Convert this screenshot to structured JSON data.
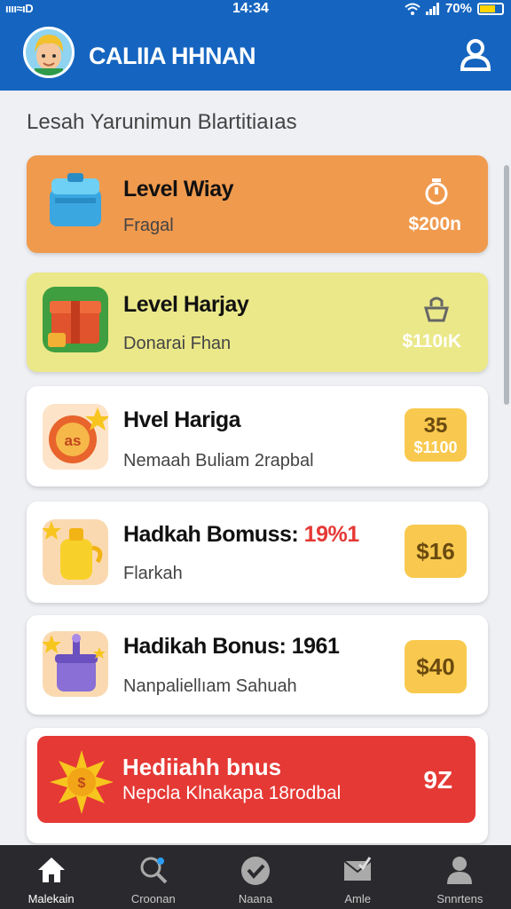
{
  "status_bar": {
    "left": "ıııı≈ıD",
    "time": "14:34",
    "battery": "70%"
  },
  "header": {
    "title": "CALIIA HHNAN"
  },
  "section_title": "Lesah Yarunimun Blartitiaıas",
  "cards": [
    {
      "title": "Level Wiay",
      "subtitle": "Fragal",
      "price": "$200n"
    },
    {
      "title": "Level Harjay",
      "subtitle": "Donarai Fhan",
      "price": "$110ıK"
    },
    {
      "title": "Hvel Hariga",
      "subtitle": "Nemaah Buliam 2rapbal",
      "badge_top": "35",
      "badge_bottom": "$1100"
    },
    {
      "title": "Hadkah Bomuss:",
      "title_highlight": "19%1",
      "subtitle": "Flarkah",
      "badge": "$16"
    },
    {
      "title": "Hadikah Bonus: 1961",
      "subtitle": "Nanpaliellıam Sahuah",
      "badge": "$40"
    }
  ],
  "promo": {
    "title": "Hediiahh bnus",
    "subtitle": "Nepcla Klnakapa 18rodbal",
    "value": "9Z"
  },
  "bottom_nav": [
    {
      "label": "Malekain",
      "icon": "home-icon",
      "active": true
    },
    {
      "label": "Croonan",
      "icon": "search-icon"
    },
    {
      "label": "Naana",
      "icon": "check-circle-icon"
    },
    {
      "label": "Amle",
      "icon": "mail-check-icon"
    },
    {
      "label": "Snnrtens",
      "icon": "person-icon"
    }
  ],
  "colors": {
    "primary": "#1565c0",
    "orange_card": "#f09a4e",
    "yellow_card": "#ebe889",
    "red_card": "#e53935",
    "nav_bg": "#2a2a2e"
  }
}
